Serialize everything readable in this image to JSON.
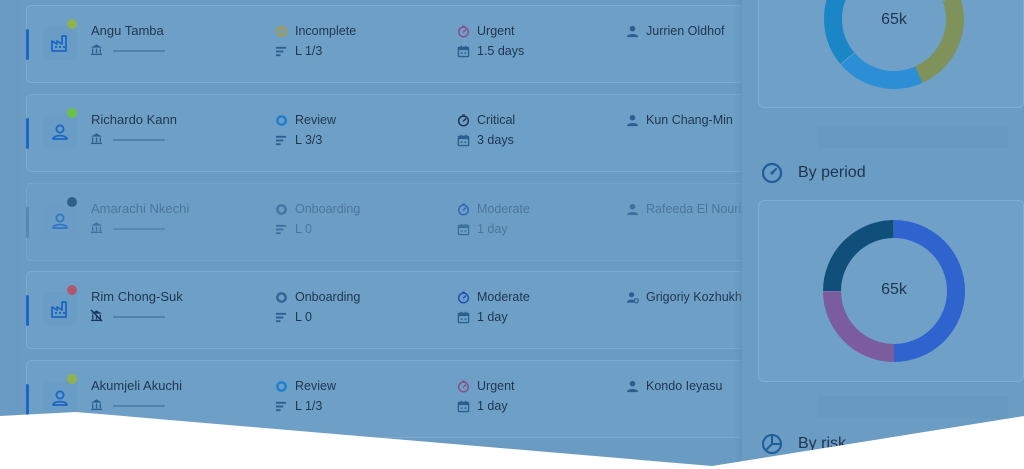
{
  "colors": {
    "accent": "#1c66c4",
    "dot_green": "#6cc04a",
    "dot_olive": "#8fb24e",
    "dot_navy": "#17476f",
    "dot_rose": "#b0586d",
    "donut_blue": "#2f64cf",
    "donut_purple": "#7b5c9e",
    "donut_navy": "#0f4f7a",
    "donut_sky": "#2c8fd6",
    "donut_olive": "#7f925c"
  },
  "rows": [
    {
      "name": "Angu Tamba",
      "avatar_icon": "factory-icon",
      "sub_icon": "bank-icon",
      "status": "Incomplete",
      "status_icon": "ring-icon",
      "level": "L 1/3",
      "priority": "Urgent",
      "priority_icon": "clock-icon",
      "duration": "1.5 days",
      "owner": "Jurrien Oldhof",
      "owner_icon": "user-icon",
      "dim": false
    },
    {
      "name": "Richardo Kann",
      "avatar_icon": "user-icon",
      "sub_icon": "bank-icon",
      "status": "Review",
      "status_icon": "ring-icon",
      "level": "L 3/3",
      "priority": "Critical",
      "priority_icon": "clock-icon",
      "duration": "3 days",
      "owner": "Kun Chang-Min",
      "owner_icon": "user-icon",
      "dim": false
    },
    {
      "name": "Amarachi Nkechi",
      "avatar_icon": "user-icon",
      "sub_icon": "bank-icon",
      "status": "Onboarding",
      "status_icon": "ring-icon",
      "level": "L 0",
      "priority": "Moderate",
      "priority_icon": "clock-icon",
      "duration": "1 day",
      "owner": "Rafeeda El Nouri",
      "owner_icon": "user-icon",
      "dim": true
    },
    {
      "name": "Rim Chong-Suk",
      "avatar_icon": "factory-icon",
      "sub_icon": "bank-off-icon",
      "status": "Onboarding",
      "status_icon": "ring-icon",
      "level": "L 0",
      "priority": "Moderate",
      "priority_icon": "clock-icon",
      "duration": "1 day",
      "owner": "Grigoriy Kozhukhov",
      "owner_icon": "user-settings-icon",
      "dim": false
    },
    {
      "name": "Akumjeli Akuchi",
      "avatar_icon": "user-icon",
      "sub_icon": "bank-icon",
      "status": "Review",
      "status_icon": "ring-icon",
      "level": "L 1/3",
      "priority": "Urgent",
      "priority_icon": "clock-icon",
      "duration": "1 day",
      "owner": "Kondo Ieyasu",
      "owner_icon": "user-icon",
      "dim": false
    }
  ],
  "panel": {
    "top_chart_value": "65k",
    "period_title": "By period",
    "period_icon": "gauge-icon",
    "period_chart_value": "65k",
    "risk_title": "By risk",
    "risk_icon": "pie-chart-icon"
  }
}
